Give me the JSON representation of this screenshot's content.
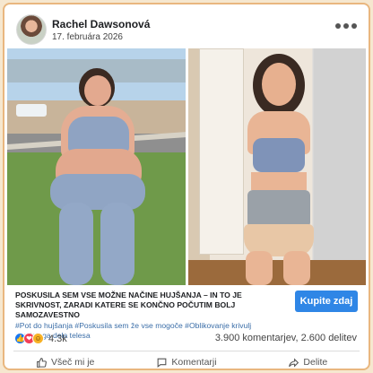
{
  "post": {
    "author": "Rachel Dawsonová",
    "date": "17. februára 2026",
    "title": "POSKUSILA SEM VSE MOŽNE NAČINE HUJŠANJA – IN TO JE SKRIVNOST, ZARADI KATERE SE KONČNO POČUTIM BOLJ SAMOZAVESTNO",
    "tags": "#Pot do hujšanja #Poskusila sem že vse mogoče #Oblikovanje krivulj spodnjega dela telesa",
    "cta_label": "Kupite zdaj"
  },
  "stats": {
    "reactions_count": "4.3k",
    "comments_shares": "3.900 komentarjev, 2.600 delitev"
  },
  "actions": {
    "like": "Všeč mi je",
    "comment": "Komentarji",
    "share": "Delite"
  },
  "colors": {
    "accent": "#2f86e6",
    "card_border": "#e9b77f",
    "like_blue": "#1877f2",
    "love_red": "#f33e58",
    "haha_yellow": "#f7b125"
  },
  "icons": [
    "more-options-icon",
    "like-reaction-icon",
    "love-reaction-icon",
    "haha-reaction-icon",
    "thumbs-up-icon",
    "comment-icon",
    "share-icon"
  ]
}
